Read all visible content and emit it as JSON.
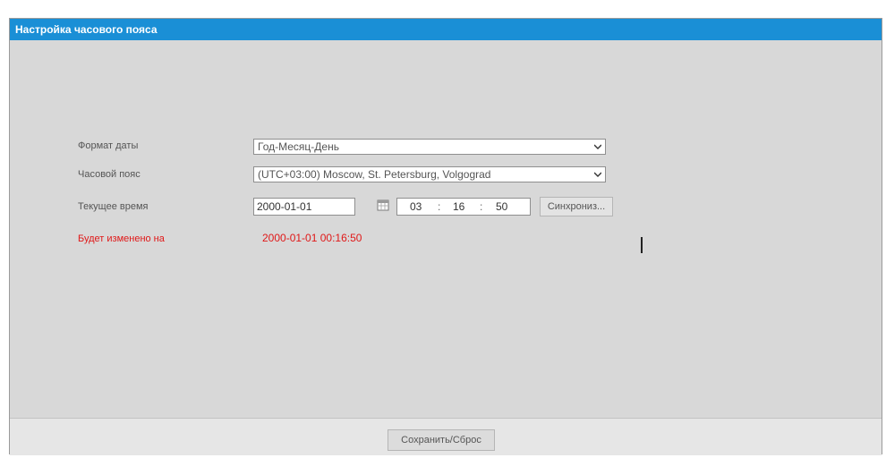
{
  "window": {
    "title": "Настройка часового пояса"
  },
  "form": {
    "date_format": {
      "label": "Формат даты",
      "value": "Год-Месяц-День"
    },
    "timezone": {
      "label": "Часовой пояс",
      "value": "(UTC+03:00) Moscow, St. Petersburg, Volgograd"
    },
    "current_time": {
      "label": "Текущее время",
      "date": "2000-01-01",
      "hour": "03",
      "minute": "16",
      "second": "50",
      "sep": ":",
      "sync_button": "Синхрониз..."
    },
    "changed_at": {
      "label": "Будет изменено на",
      "value": "2000-01-01 00:16:50"
    }
  },
  "footer": {
    "save_button": "Сохранить/Сброс"
  },
  "colors": {
    "titlebar": "#1a8fd6",
    "warning": "#e01818",
    "panel": "#d8d8d8"
  },
  "icons": {
    "dropdown": "chevron-down-icon",
    "calendar": "calendar-icon"
  }
}
